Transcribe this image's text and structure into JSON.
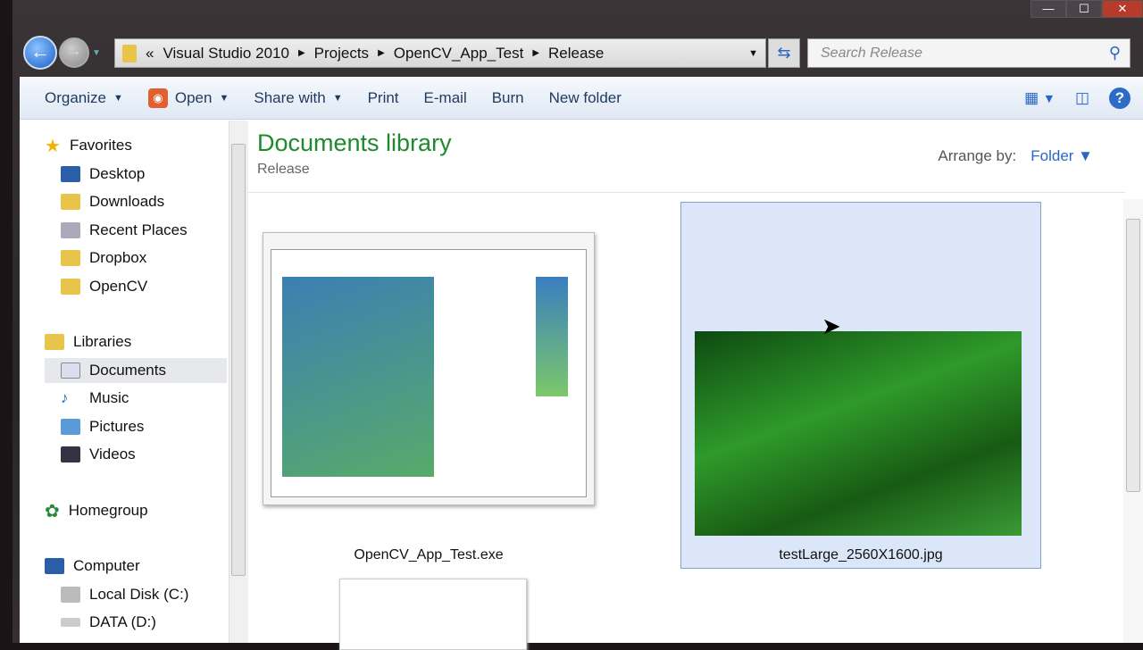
{
  "window": {
    "minimize": "—",
    "maximize": "☐",
    "close": "✕"
  },
  "address": {
    "overflow": "«",
    "crumbs": [
      "Visual Studio 2010",
      "Projects",
      "OpenCV_App_Test",
      "Release"
    ]
  },
  "search": {
    "placeholder": "Search Release"
  },
  "toolbar": {
    "organize": "Organize",
    "open": "Open",
    "share": "Share with",
    "print": "Print",
    "email": "E-mail",
    "burn": "Burn",
    "new_folder": "New folder"
  },
  "sidebar": {
    "favorites": "Favorites",
    "fav_items": [
      "Desktop",
      "Downloads",
      "Recent Places",
      "Dropbox",
      "OpenCV"
    ],
    "libraries": "Libraries",
    "lib_items": [
      "Documents",
      "Music",
      "Pictures",
      "Videos"
    ],
    "homegroup": "Homegroup",
    "computer": "Computer",
    "drives": [
      "Local Disk (C:)",
      "DATA (D:)"
    ]
  },
  "main": {
    "title": "Documents library",
    "subtitle": "Release",
    "arrange_label": "Arrange by:",
    "arrange_value": "Folder",
    "files": [
      "OpenCV_App_Test.exe",
      "testLarge_2560X1600.jpg"
    ]
  }
}
